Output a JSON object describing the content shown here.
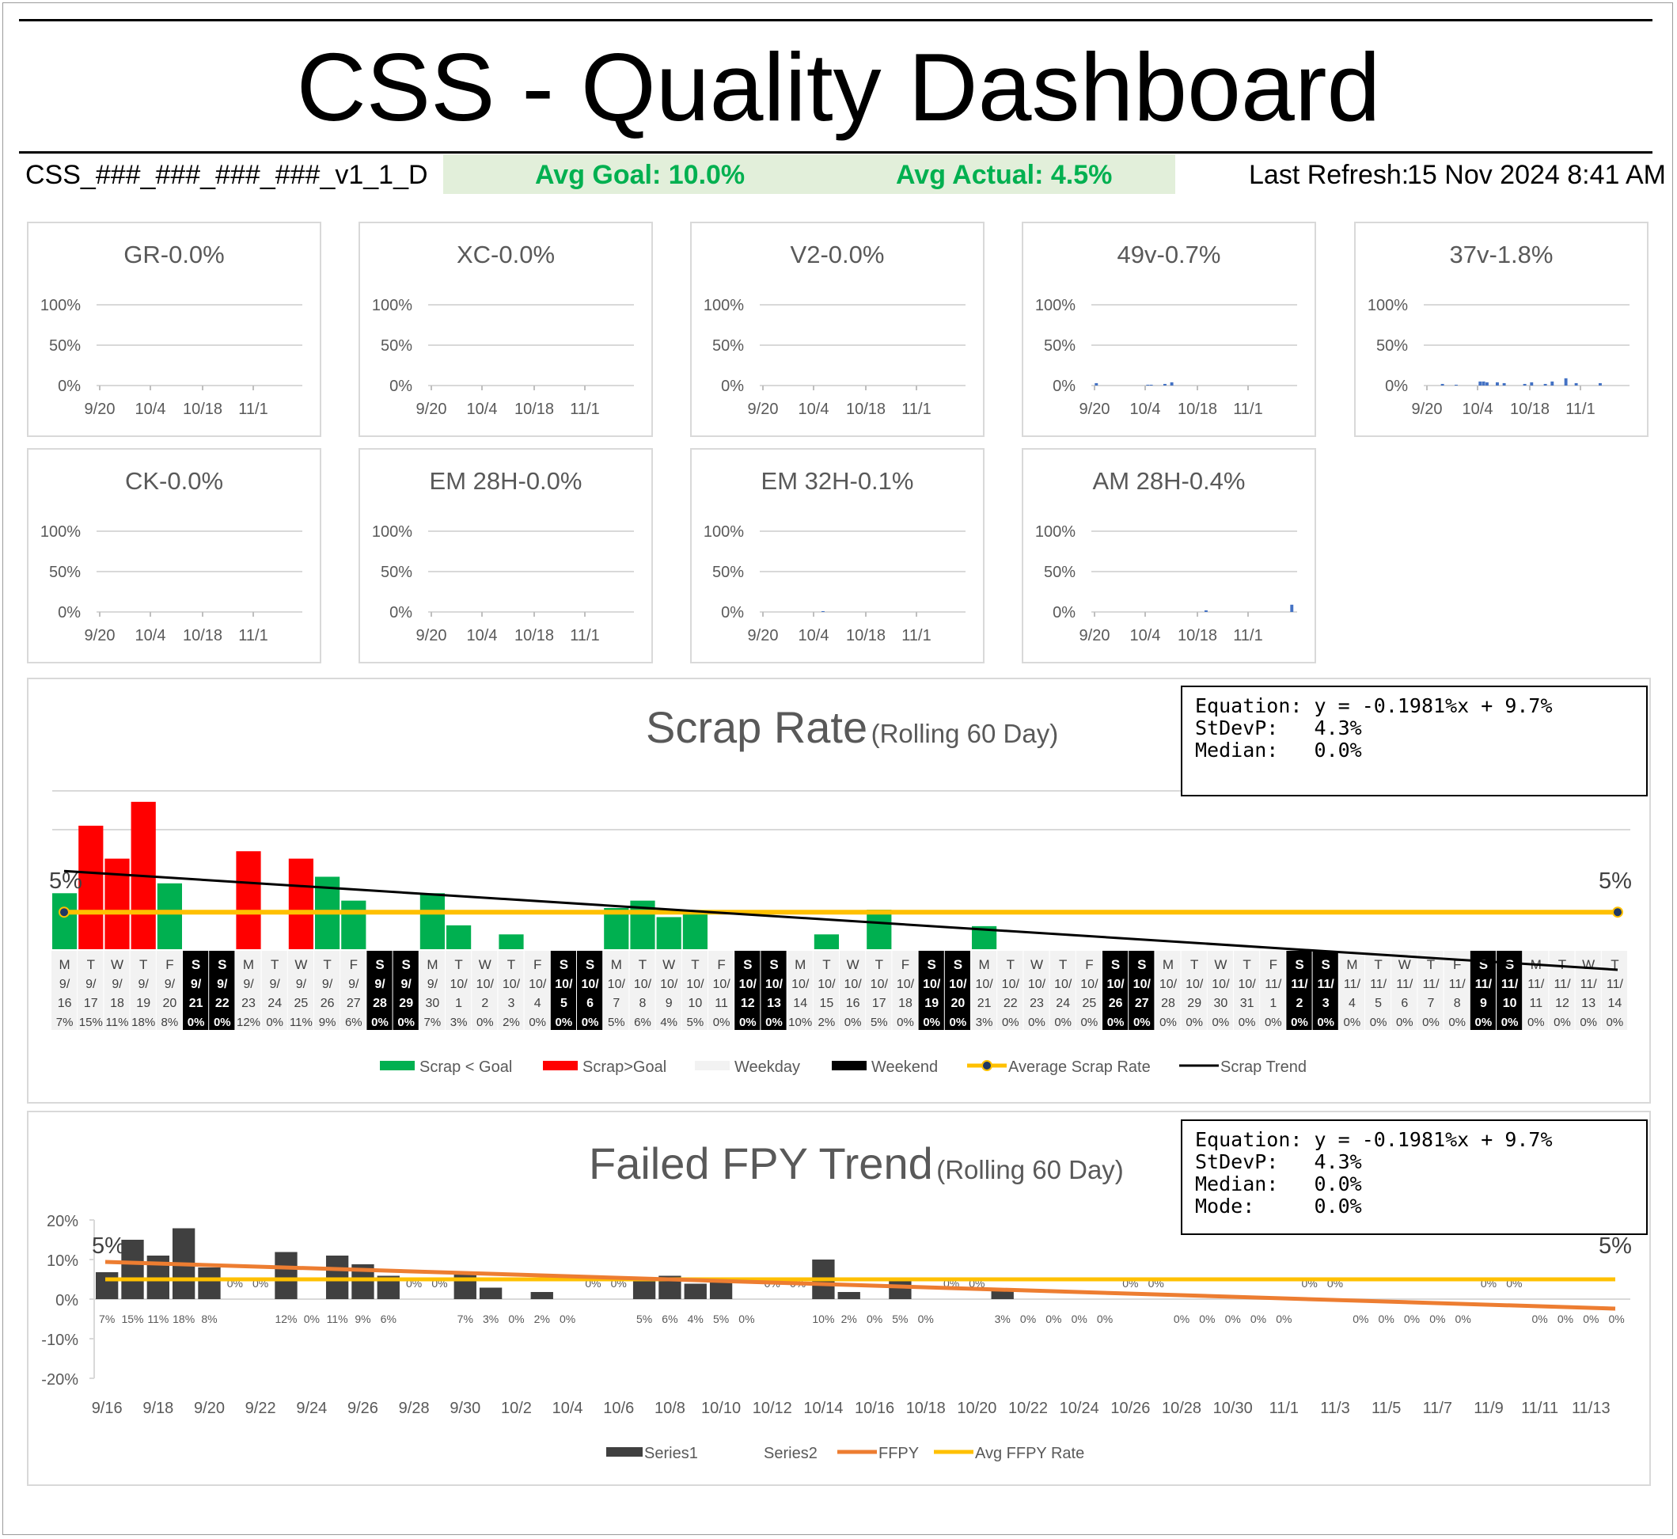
{
  "header": {
    "title": "CSS - Quality Dashboard",
    "file_name": "CSS_###_###_###_###_v1_1_D",
    "avg_goal": "Avg Goal: 10.0%",
    "avg_actual": "Avg Actual: 4.5%",
    "last_refresh_label": "Last Refresh:",
    "last_refresh_value": "15 Nov 2024 8:41 AM"
  },
  "colors": {
    "scrap_below_goal": "#00b050",
    "scrap_above_goal": "#ff0000",
    "weekday": "#f2f2f2",
    "weekend": "#000000",
    "average": "#ffc000",
    "trend": "#000000",
    "fpy_bar": "#404040",
    "fpy_trend": "#ed7d31",
    "small_bar": "#4472c4",
    "goal_band": "#e2efda",
    "goal_text": "#00b050"
  },
  "small_panels": [
    {
      "title": "GR-0.0%",
      "yticks": [
        "100%",
        "50%",
        "0%"
      ],
      "xticks": [
        "9/20",
        "10/4",
        "10/18",
        "11/1"
      ],
      "values": []
    },
    {
      "title": "XC-0.0%",
      "yticks": [
        "100%",
        "50%",
        "0%"
      ],
      "xticks": [
        "9/20",
        "10/4",
        "10/18",
        "11/1"
      ],
      "values": []
    },
    {
      "title": "V2-0.0%",
      "yticks": [
        "100%",
        "50%",
        "0%"
      ],
      "xticks": [
        "9/20",
        "10/4",
        "10/18",
        "11/1"
      ],
      "values": []
    },
    {
      "title": "49v-0.7%",
      "yticks": [
        "100%",
        "50%",
        "0%"
      ],
      "xticks": [
        "9/20",
        "10/4",
        "10/18",
        "11/1"
      ],
      "values": [
        0,
        3,
        0,
        0,
        0,
        0,
        0,
        0,
        0,
        0,
        0,
        0,
        0,
        0,
        0,
        0,
        1,
        1,
        0,
        0,
        0,
        2,
        0,
        4,
        0,
        0,
        0,
        0,
        0,
        0,
        0,
        0,
        0,
        0,
        0,
        0,
        0,
        0,
        0,
        0,
        0,
        0,
        0,
        0,
        0,
        0,
        0,
        0,
        0,
        0,
        0,
        0,
        0,
        0,
        0,
        0,
        0,
        0,
        0,
        0
      ]
    },
    {
      "title": "37v-1.8%",
      "yticks": [
        "100%",
        "50%",
        "0%"
      ],
      "xticks": [
        "9/20",
        "10/4",
        "10/18",
        "11/1"
      ],
      "values": [
        0,
        0,
        0,
        0,
        0,
        2,
        0,
        0,
        0,
        1,
        0,
        0,
        0,
        0,
        0,
        0,
        5,
        5,
        4,
        0,
        0,
        4,
        0,
        3,
        0,
        0,
        0,
        0,
        0,
        2,
        0,
        4,
        0,
        0,
        0,
        2,
        0,
        5,
        0,
        0,
        0,
        9,
        0,
        0,
        3,
        0,
        0,
        0,
        0,
        0,
        0,
        3,
        0,
        0,
        0,
        0,
        0,
        0,
        0,
        0
      ]
    },
    {
      "title": "CK-0.0%",
      "yticks": [
        "100%",
        "50%",
        "0%"
      ],
      "xticks": [
        "9/20",
        "10/4",
        "10/18",
        "11/1"
      ],
      "values": []
    },
    {
      "title": "EM 28H-0.0%",
      "yticks": [
        "100%",
        "50%",
        "0%"
      ],
      "xticks": [
        "9/20",
        "10/4",
        "10/18",
        "11/1"
      ],
      "values": []
    },
    {
      "title": "EM 32H-0.1%",
      "yticks": [
        "100%",
        "50%",
        "0%"
      ],
      "xticks": [
        "9/20",
        "10/4",
        "10/18",
        "11/1"
      ],
      "values": [
        0,
        0,
        0,
        0,
        0,
        0,
        0,
        0,
        0,
        0,
        0,
        0,
        0,
        0,
        0,
        0,
        0,
        0,
        1,
        0,
        0,
        0,
        0,
        0,
        0,
        0,
        0,
        0,
        0,
        0,
        0,
        0,
        0,
        0,
        0,
        0,
        0,
        0,
        0,
        0,
        0,
        0,
        0,
        0,
        0,
        0,
        0,
        0,
        0,
        0,
        0,
        0,
        0,
        0,
        0,
        0,
        0,
        0,
        0,
        0
      ]
    },
    {
      "title": "AM 28H-0.4%",
      "yticks": [
        "100%",
        "50%",
        "0%"
      ],
      "xticks": [
        "9/20",
        "10/4",
        "10/18",
        "11/1"
      ],
      "values": [
        0,
        0,
        0,
        0,
        0,
        0,
        0,
        0,
        0,
        0,
        0,
        0,
        0,
        0,
        0,
        0,
        0,
        0,
        0,
        0,
        0,
        0,
        0,
        0,
        0,
        0,
        0,
        0,
        0,
        0,
        0,
        0,
        0,
        2,
        0,
        0,
        0,
        0,
        0,
        0,
        0,
        0,
        0,
        0,
        0,
        0,
        0,
        0,
        0,
        0,
        0,
        0,
        0,
        0,
        0,
        0,
        0,
        0,
        9,
        0
      ]
    }
  ],
  "chart_data": [
    {
      "type": "bar",
      "title": "Scrap Rate",
      "subtitle": "(Rolling 60 Day)",
      "days": [
        "M",
        "T",
        "W",
        "T",
        "F",
        "S",
        "S",
        "M",
        "T",
        "W",
        "T",
        "F",
        "S",
        "S",
        "M",
        "T",
        "W",
        "T",
        "F",
        "S",
        "S",
        "M",
        "T",
        "W",
        "T",
        "F",
        "S",
        "S",
        "M",
        "T",
        "W",
        "T",
        "F",
        "S",
        "S",
        "M",
        "T",
        "W",
        "T",
        "F",
        "S",
        "S",
        "M",
        "T",
        "W",
        "T",
        "F",
        "S",
        "S",
        "M",
        "T",
        "W",
        "T",
        "F",
        "S",
        "S",
        "M",
        "T",
        "W",
        "T"
      ],
      "dates_top": [
        "9/",
        "9/",
        "9/",
        "9/",
        "9/",
        "9/",
        "9/",
        "9/",
        "9/",
        "9/",
        "9/",
        "9/",
        "9/",
        "9/",
        "9/",
        "10/",
        "10/",
        "10/",
        "10/",
        "10/",
        "10/",
        "10/",
        "10/",
        "10/",
        "10/",
        "10/",
        "10/",
        "10/",
        "10/",
        "10/",
        "10/",
        "10/",
        "10/",
        "10/",
        "10/",
        "10/",
        "10/",
        "10/",
        "10/",
        "10/",
        "10/",
        "10/",
        "10/",
        "10/",
        "10/",
        "10/",
        "11/",
        "11/",
        "11/",
        "11/",
        "11/",
        "11/",
        "11/",
        "11/",
        "11/",
        "11/",
        "11/",
        "11/",
        "11/",
        "11/"
      ],
      "dates_bottom": [
        "16",
        "17",
        "18",
        "19",
        "20",
        "21",
        "22",
        "23",
        "24",
        "25",
        "26",
        "27",
        "28",
        "29",
        "30",
        "1",
        "2",
        "3",
        "4",
        "5",
        "6",
        "7",
        "8",
        "9",
        "10",
        "11",
        "12",
        "13",
        "14",
        "15",
        "16",
        "17",
        "18",
        "19",
        "20",
        "21",
        "22",
        "23",
        "24",
        "25",
        "26",
        "27",
        "28",
        "29",
        "30",
        "31",
        "1",
        "2",
        "3",
        "4",
        "5",
        "6",
        "7",
        "8",
        "9",
        "10",
        "11",
        "12",
        "13",
        "14"
      ],
      "value_labels": [
        "7%",
        "15%",
        "11%",
        "18%",
        "8%",
        "0%",
        "0%",
        "12%",
        "0%",
        "11%",
        "9%",
        "6%",
        "0%",
        "0%",
        "7%",
        "3%",
        "0%",
        "2%",
        "0%",
        "0%",
        "0%",
        "5%",
        "6%",
        "4%",
        "5%",
        "0%",
        "0%",
        "0%",
        "10%",
        "2%",
        "0%",
        "5%",
        "0%",
        "0%",
        "0%",
        "3%",
        "0%",
        "0%",
        "0%",
        "0%",
        "0%",
        "0%",
        "0%",
        "0%",
        "0%",
        "0%",
        "0%",
        "0%",
        "0%",
        "0%",
        "0%",
        "0%",
        "0%",
        "0%",
        "0%",
        "0%",
        "0%",
        "0%",
        "0%",
        "0%"
      ],
      "values": [
        6.8,
        15,
        11,
        17.9,
        8,
        0,
        0,
        11.9,
        0,
        11,
        8.8,
        5.9,
        0,
        0,
        6.8,
        2.9,
        0,
        1.8,
        0,
        0,
        0,
        5,
        5.9,
        3.9,
        4.7,
        0,
        0,
        0,
        0,
        1.8,
        0,
        4.8,
        0,
        0,
        0,
        2.8,
        0,
        0,
        0,
        0,
        0,
        0,
        0,
        0,
        0,
        0,
        0,
        0,
        0,
        0,
        0,
        0,
        0,
        0,
        0,
        0,
        0,
        0,
        0,
        0
      ],
      "weekend": [
        false,
        false,
        false,
        false,
        false,
        true,
        true,
        false,
        false,
        false,
        false,
        false,
        true,
        true,
        false,
        false,
        false,
        false,
        false,
        true,
        true,
        false,
        false,
        false,
        false,
        false,
        true,
        true,
        false,
        false,
        false,
        false,
        false,
        true,
        true,
        false,
        false,
        false,
        false,
        false,
        true,
        true,
        false,
        false,
        false,
        false,
        false,
        true,
        true,
        false,
        false,
        false,
        false,
        false,
        true,
        true,
        false,
        false,
        false,
        false
      ],
      "goal": 10,
      "average": 4.5,
      "trend": {
        "start": 9.5,
        "end": -2.5
      },
      "avg_label_left": "5%",
      "avg_label_right": "5%",
      "stats": {
        "equation": "Equation: y = -0.1981%x + 9.7%",
        "stdev": "StDevP:   4.3%",
        "median": "Median:   0.0%"
      },
      "legend": [
        "Scrap < Goal",
        "Scrap>Goal",
        "Weekday",
        "Weekend",
        "Average Scrap Rate",
        "Scrap Trend"
      ]
    },
    {
      "type": "bar",
      "title": "Failed FPY Trend",
      "subtitle": "(Rolling 60 Day)",
      "yticks": [
        "20%",
        "10%",
        "0%",
        "-10%",
        "-20%"
      ],
      "ylim": [
        -20,
        20
      ],
      "xticks": [
        "9/16",
        "9/18",
        "9/20",
        "9/22",
        "9/24",
        "9/26",
        "9/28",
        "9/30",
        "10/2",
        "10/4",
        "10/6",
        "10/8",
        "10/10",
        "10/12",
        "10/14",
        "10/16",
        "10/18",
        "10/20",
        "10/22",
        "10/24",
        "10/26",
        "10/28",
        "10/30",
        "11/1",
        "11/3",
        "11/5",
        "11/7",
        "11/9",
        "11/11",
        "11/13"
      ],
      "values": [
        6.8,
        15,
        11,
        17.9,
        8,
        0,
        0,
        11.9,
        0,
        11,
        8.8,
        5.9,
        0,
        0,
        6.8,
        2.9,
        0,
        1.8,
        0,
        0,
        0,
        5,
        5.9,
        3.9,
        4.7,
        0,
        0,
        0,
        10,
        1.8,
        0,
        4.8,
        0,
        0,
        0,
        2.8,
        0,
        0,
        0,
        0,
        0,
        0,
        0,
        0,
        0,
        0,
        0,
        0,
        0,
        0,
        0,
        0,
        0,
        0,
        0,
        0,
        0,
        0,
        0,
        0
      ],
      "value_labels": [
        "7%",
        "15%",
        "11%",
        "18%",
        "8%",
        "",
        "",
        "12%",
        "0%",
        "11%",
        "9%",
        "6%",
        "",
        "",
        "7%",
        "3%",
        "0%",
        "2%",
        "0%",
        "",
        "",
        "5%",
        "6%",
        "4%",
        "5%",
        "0%",
        "",
        "",
        "10%",
        "2%",
        "0%",
        "5%",
        "0%",
        "",
        "",
        "3%",
        "0%",
        "0%",
        "0%",
        "0%",
        "",
        "",
        "0%",
        "0%",
        "0%",
        "0%",
        "0%",
        "",
        "",
        "0%",
        "0%",
        "0%",
        "0%",
        "0%",
        "",
        "",
        "0%",
        "0%",
        "0%",
        "0%"
      ],
      "weekend_labels": [
        "",
        "",
        "",
        "",
        "",
        "0%",
        "0%",
        "",
        "",
        "",
        "",
        "",
        "0%",
        "0%",
        "",
        "",
        "",
        "",
        "",
        "0%",
        "0%",
        "",
        "",
        "",
        "",
        "",
        "0%",
        "0%",
        "",
        "",
        "",
        "",
        "",
        "0%",
        "0%",
        "",
        "",
        "",
        "",
        "",
        "0%",
        "0%",
        "",
        "",
        "",
        "",
        "",
        "0%",
        "0%",
        "",
        "",
        "",
        "",
        "",
        "0%",
        "0%",
        "",
        "",
        "",
        "",
        ""
      ],
      "average": 5,
      "trend": {
        "start": 9.4,
        "end": -2.4
      },
      "avg_label_left": "5%",
      "avg_label_right": "5%",
      "stats": {
        "equation": "Equation: y = -0.1981%x + 9.7%",
        "stdev": "StDevP:   4.3%",
        "median": "Median:   0.0%",
        "mode": "Mode:     0.0%"
      },
      "legend": [
        "Series1",
        "Series2",
        "FFPY",
        "Avg FFPY Rate"
      ]
    }
  ]
}
